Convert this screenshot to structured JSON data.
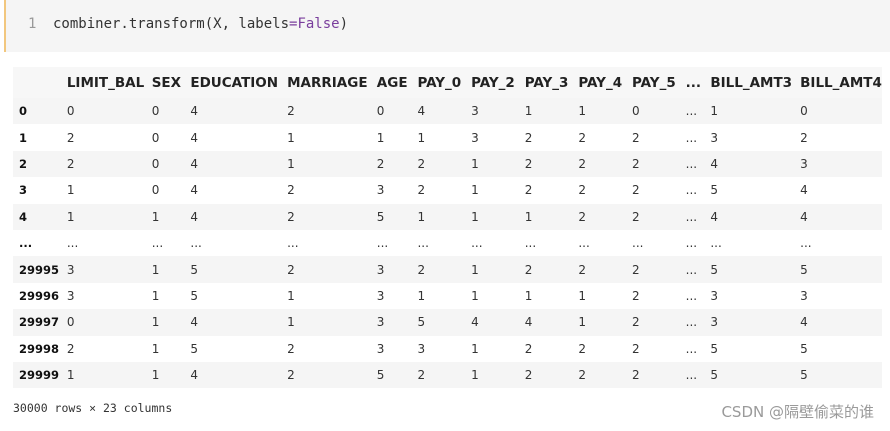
{
  "code_cell": {
    "line_number": "1",
    "code_prefix": "combiner.transform(X, labels",
    "code_op": "=",
    "code_keyword": "False",
    "code_suffix": ")"
  },
  "dataframe": {
    "columns": [
      "",
      "LIMIT_BAL",
      "SEX",
      "EDUCATION",
      "MARRIAGE",
      "AGE",
      "PAY_0",
      "PAY_2",
      "PAY_3",
      "PAY_4",
      "PAY_5",
      "...",
      "BILL_AMT3",
      "BILL_AMT4"
    ],
    "rows": [
      [
        "0",
        "0",
        "0",
        "4",
        "2",
        "0",
        "4",
        "3",
        "1",
        "1",
        "0",
        "...",
        "1",
        "0"
      ],
      [
        "1",
        "2",
        "0",
        "4",
        "1",
        "1",
        "1",
        "3",
        "2",
        "2",
        "2",
        "...",
        "3",
        "2"
      ],
      [
        "2",
        "2",
        "0",
        "4",
        "1",
        "2",
        "2",
        "1",
        "2",
        "2",
        "2",
        "...",
        "4",
        "3"
      ],
      [
        "3",
        "1",
        "0",
        "4",
        "2",
        "3",
        "2",
        "1",
        "2",
        "2",
        "2",
        "...",
        "5",
        "4"
      ],
      [
        "4",
        "1",
        "1",
        "4",
        "2",
        "5",
        "1",
        "1",
        "1",
        "2",
        "2",
        "...",
        "4",
        "4"
      ],
      [
        "...",
        "...",
        "...",
        "...",
        "...",
        "...",
        "...",
        "...",
        "...",
        "...",
        "...",
        "...",
        "...",
        "..."
      ],
      [
        "29995",
        "3",
        "1",
        "5",
        "2",
        "3",
        "2",
        "1",
        "2",
        "2",
        "2",
        "...",
        "5",
        "5"
      ],
      [
        "29996",
        "3",
        "1",
        "5",
        "1",
        "3",
        "1",
        "1",
        "1",
        "1",
        "2",
        "...",
        "3",
        "3"
      ],
      [
        "29997",
        "0",
        "1",
        "4",
        "1",
        "3",
        "5",
        "4",
        "4",
        "1",
        "2",
        "...",
        "3",
        "4"
      ],
      [
        "29998",
        "2",
        "1",
        "5",
        "2",
        "3",
        "3",
        "1",
        "2",
        "2",
        "2",
        "...",
        "5",
        "5"
      ],
      [
        "29999",
        "1",
        "1",
        "4",
        "2",
        "5",
        "2",
        "1",
        "2",
        "2",
        "2",
        "...",
        "5",
        "5"
      ]
    ]
  },
  "shape_note": "30000 rows × 23 columns",
  "watermark": "CSDN @隔壁偷菜的谁"
}
